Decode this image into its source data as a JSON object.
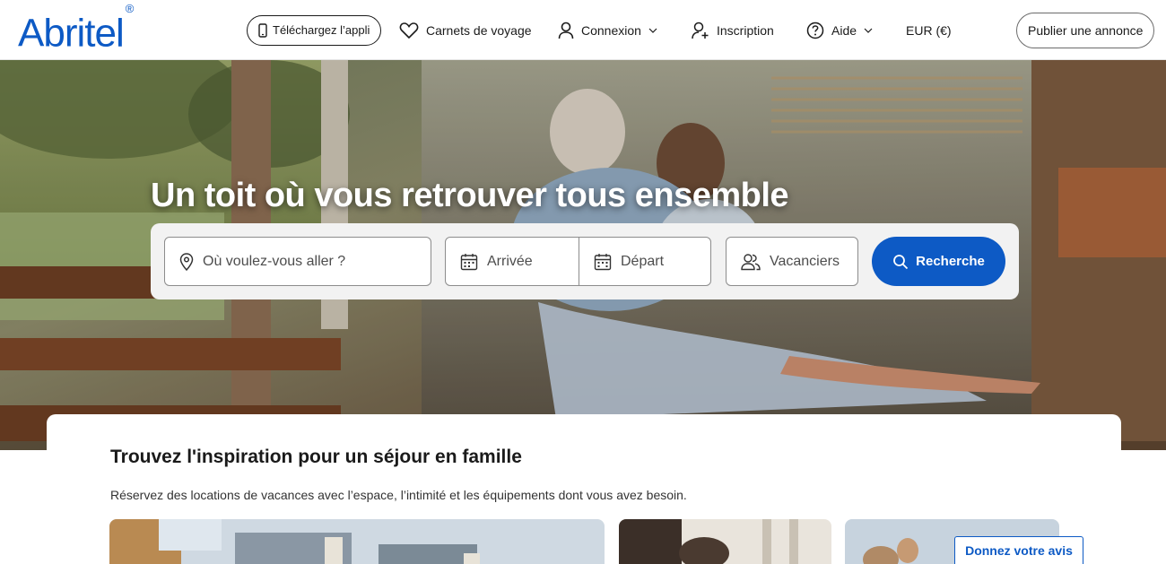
{
  "brand": {
    "name": "Abritel",
    "mark": "®",
    "color": "#0d5ac5"
  },
  "header": {
    "app_pill": "Téléchargez l’appli",
    "trips": "Carnets de voyage",
    "login": "Connexion",
    "signup": "Inscription",
    "help": "Aide",
    "currency": "EUR (€)",
    "language_flag": "flag-fr-icon",
    "publish": "Publier une annonce"
  },
  "hero": {
    "title": "Un toit où vous retrouver tous ensemble"
  },
  "search": {
    "destination_placeholder": "Où voulez-vous aller ?",
    "checkin_label": "Arrivée",
    "checkout_label": "Départ",
    "travelers_label": "Vacanciers",
    "button_label": "Recherche"
  },
  "section": {
    "title": "Trouvez l'inspiration pour un séjour en famille",
    "subtitle": "Réservez des locations de vacances avec l’espace, l’intimité et les équipements dont vous avez besoin."
  },
  "feedback_tab": "Donnez votre avis"
}
